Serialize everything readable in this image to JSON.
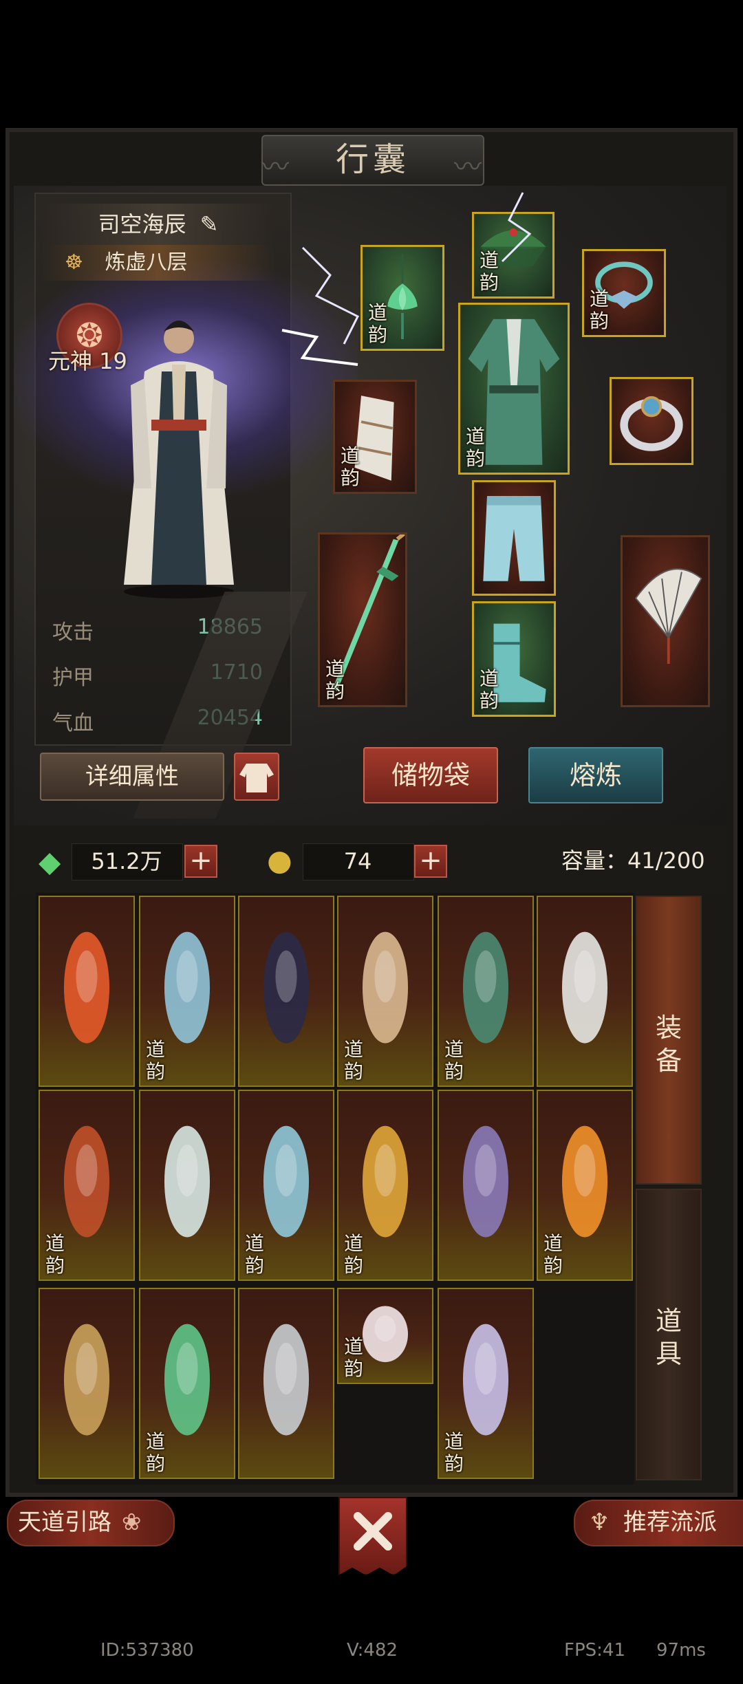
{
  "window": {
    "title": "行囊"
  },
  "character": {
    "name": "司空海辰",
    "realm": "炼虚八层",
    "soul_label": "元神 19",
    "stats": [
      {
        "label": "攻击",
        "value": "18865"
      },
      {
        "label": "护甲",
        "value": "1710"
      },
      {
        "label": "气血",
        "value": "20454"
      }
    ]
  },
  "tag_text": "道韵",
  "buttons": {
    "detail": "详细属性",
    "storage": "储物袋",
    "smelt": "熔炼"
  },
  "currency": {
    "spirit_stone": "51.2万",
    "essence": "74",
    "capacity": "容量：41/200"
  },
  "side_tabs": {
    "equip": "装备",
    "items": "道具"
  },
  "bottom": {
    "guide": "天道引路",
    "recommend": "推荐流派"
  },
  "footer": {
    "id": "ID:537380",
    "version": "V:482",
    "fps": "FPS:41",
    "latency": "97ms"
  },
  "colors": {
    "gold_border": "#c9a51d",
    "stat_value": "#7fc4a8",
    "red_button": "#a3392c",
    "teal_button": "#2f6670"
  },
  "equipped_slots": [
    {
      "name": "pendant-slot",
      "icon": "lotus-pendant-icon",
      "tag": true
    },
    {
      "name": "hat-slot",
      "icon": "bamboo-hat-icon",
      "tag": true
    },
    {
      "name": "necklace-slot",
      "icon": "jade-necklace-icon",
      "tag": true
    },
    {
      "name": "robe-slot",
      "icon": "green-robe-icon",
      "tag": true
    },
    {
      "name": "bracer-slot",
      "icon": "bracer-icon",
      "tag": true
    },
    {
      "name": "ring-slot",
      "icon": "silver-ring-icon",
      "tag": false
    },
    {
      "name": "pants-slot",
      "icon": "blue-pants-icon",
      "tag": false
    },
    {
      "name": "weapon-slot",
      "icon": "jade-sword-icon",
      "tag": true
    },
    {
      "name": "boots-slot",
      "icon": "green-boots-icon",
      "tag": true
    },
    {
      "name": "fan-slot",
      "icon": "paper-fan-icon",
      "tag": false
    }
  ],
  "bag_items": [
    {
      "icon": "flame-sword-icon",
      "tag": false
    },
    {
      "icon": "ice-sword-icon",
      "tag": true
    },
    {
      "icon": "brush-icon",
      "tag": false
    },
    {
      "icon": "pipa-icon",
      "tag": true
    },
    {
      "icon": "green-robe-icon",
      "tag": true
    },
    {
      "icon": "white-robe-icon",
      "tag": false
    },
    {
      "icon": "dark-robe-icon",
      "tag": true
    },
    {
      "icon": "white-bracer-icon",
      "tag": false
    },
    {
      "icon": "blue-bracer-icon",
      "tag": true
    },
    {
      "icon": "phoenix-hairpin-icon",
      "tag": true
    },
    {
      "icon": "dragon-hairpin-icon",
      "tag": false
    },
    {
      "icon": "moon-pendant-icon",
      "tag": true
    },
    {
      "icon": "lantern-pendant-icon",
      "tag": false
    },
    {
      "icon": "jade-pendant-icon",
      "tag": true
    },
    {
      "icon": "silver-pendant-icon",
      "tag": false
    },
    {
      "icon": "lotus-ring-icon",
      "tag": true
    },
    {
      "icon": "lavender-pants-icon",
      "tag": true
    }
  ]
}
